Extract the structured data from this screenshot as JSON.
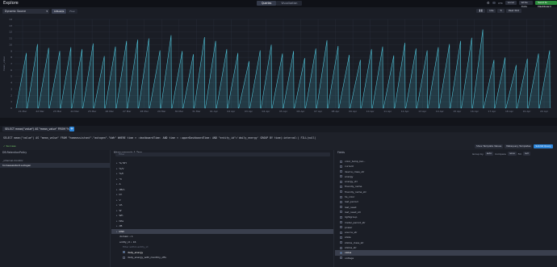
{
  "app": {
    "title": "Explore"
  },
  "mode_tabs": [
    "Queries",
    "Visualization"
  ],
  "top_right": {
    "toggle_label": "UTC",
    "local_label": "Local",
    "write_label": "Write Data",
    "send_label": "Send to Dashboard"
  },
  "source": {
    "value": "Dynamic Source"
  },
  "view_tabs": [
    "InfluxQL",
    "Flux"
  ],
  "graph_controls": {
    "refresh_label": "10s",
    "paused_label": "Past 30d"
  },
  "chart_data": {
    "type": "line",
    "ylim": [
      0,
      14
    ],
    "y_ticks": [
      0,
      1,
      2,
      3,
      4,
      5,
      6,
      7,
      8,
      9,
      10,
      11,
      12,
      13,
      14
    ],
    "ylabel": "mean_value",
    "x_ticks": [
      "21 Mar",
      "22 Mar",
      "23 Mar",
      "24 Mar",
      "25 Mar",
      "26 Mar",
      "27 Mar",
      "28 Mar",
      "29 Mar",
      "30 Mar",
      "31 Mar",
      "01 Apr",
      "02 Apr",
      "03 Apr",
      "04 Apr",
      "05 Apr",
      "06 Apr",
      "07 Apr",
      "08 Apr",
      "09 Apr",
      "10 Apr",
      "11 Apr",
      "12 Apr",
      "13 Apr",
      "14 Apr",
      "15 Apr",
      "16 Apr",
      "17 Apr",
      "18 Apr",
      "19 Apr",
      "20 Apr"
    ],
    "series": [
      {
        "color": "#4fc1d6",
        "peaks": [
          8.7,
          10.1,
          9.5,
          9.0,
          9.6,
          9.3,
          10.2,
          8.2,
          9.7,
          10.6,
          10.8,
          11.0,
          9.1,
          11.5,
          9.0,
          8.5,
          11.2,
          10.6,
          9.3,
          8.7,
          7.4,
          9.1,
          10.0,
          8.6,
          9.0,
          7.9,
          9.4,
          10.7,
          9.8,
          8.4,
          7.6,
          9.3,
          9.7,
          8.3,
          10.3,
          9.4,
          9.1,
          9.6,
          10.1,
          10.6,
          11.1,
          12.4,
          7.6,
          8.0,
          6.8,
          7.8,
          8.6,
          9.1
        ]
      }
    ]
  },
  "query_tab": {
    "label": "SELECT mean(\"value\") AS \"mean_value\" FROM \"h..."
  },
  "query": {
    "text": "SELECT mean(\"value\") AS \"mean_value\" FROM \"homeassistant\".\"autogen\".\"kWh\" WHERE time > :dashboardTime: AND time < :upperDashboardTime: AND \"entity_id\"='daily_energy' GROUP BY time(:interval:) FILL(null)",
    "status": "✓ Success",
    "template_label": "Show Template Values",
    "metaquery_label": "Metaquery Templates",
    "submit_label": "Submit Query"
  },
  "db_col": {
    "header": "DB.RetentionPolicy",
    "items": [
      "_internal.monitor",
      "homeassistant.autogen"
    ]
  },
  "meas_col": {
    "header": "Measurements & Tags",
    "search_placeholder": "Filter",
    "items": [
      "%/ RH",
      "%/V",
      "%/h",
      "°C",
      "A",
      "dBm",
      "lm",
      "V",
      "VA",
      "W",
      "Wh",
      "hPa",
      "dB",
      "kWh"
    ],
    "sub_items": [
      "domain • 1",
      "entity_id • 16"
    ],
    "entity_filter": "Filter within entity_id",
    "entities": [
      "daily_energy",
      "daily_energy_with_monthly_offs"
    ],
    "group_by_label": "Group By entity_id"
  },
  "fields_col": {
    "header": "Fields",
    "group_by_label": "Group by",
    "group_by_value": "auto",
    "compare_label": "Compare",
    "compare_value": "none",
    "fill_label": "Fill",
    "fill_value": "null",
    "items": [
      "color_temp_kel...",
      "current",
      "device_class_str",
      "energy",
      "energy_str",
      "friendly_name",
      "friendly_name_str",
      "hs_color",
      "last_period",
      "last_reset",
      "last_reset_str",
      "lightgroup",
      "meter_period_str",
      "power",
      "source_str",
      "state",
      "status_class_str",
      "status_str",
      "value",
      "voltage"
    ]
  }
}
